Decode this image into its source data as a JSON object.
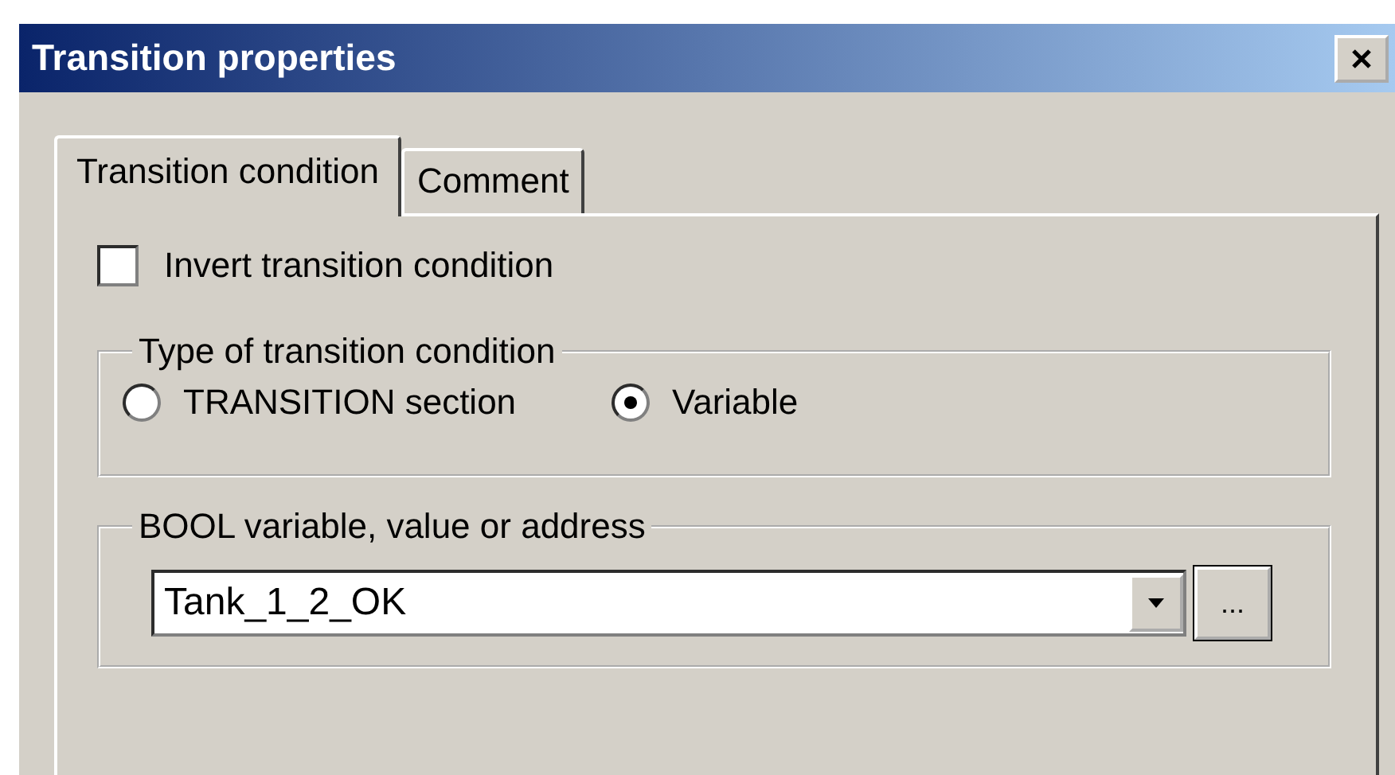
{
  "window": {
    "title": "Transition properties"
  },
  "tabs": [
    {
      "label": "Transition condition",
      "selected": true
    },
    {
      "label": "Comment",
      "selected": false
    }
  ],
  "invert_checkbox": {
    "label": "Invert transition condition",
    "checked": false
  },
  "condition_type": {
    "title": "Type of transition condition",
    "options": [
      {
        "label": "TRANSITION section",
        "selected": false
      },
      {
        "label": "Variable",
        "selected": true
      }
    ]
  },
  "variable_group": {
    "title": "BOOL variable, value or address",
    "value": "Tank_1_2_OK",
    "browse_button": "..."
  }
}
